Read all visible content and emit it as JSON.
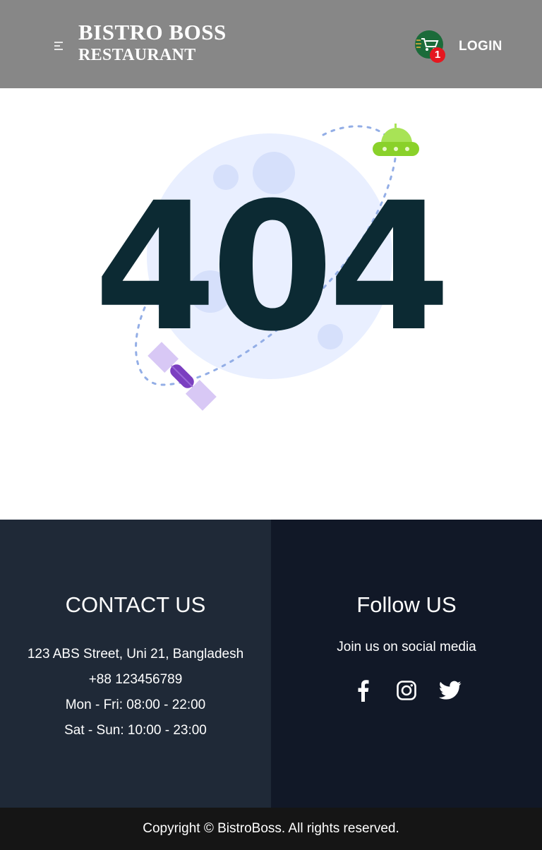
{
  "header": {
    "brand_line1": "BISTRO BOSS",
    "brand_line2": "RESTAURANT",
    "cart_count": "1",
    "login_label": "LOGIN",
    "menu_icon": "hamburger-menu-icon",
    "cart_icon": "shopping-cart-icon"
  },
  "error": {
    "code": "404"
  },
  "contact": {
    "title": "CONTACT US",
    "address": "123 ABS Street, Uni 21, Bangladesh",
    "phone": "+88 123456789",
    "weekday_hours": "Mon - Fri: 08:00 - 22:00",
    "weekend_hours": "Sat - Sun: 10:00 - 23:00"
  },
  "follow": {
    "title": "Follow US",
    "subtitle": "Join us on social media",
    "icons": [
      "facebook-icon",
      "instagram-icon",
      "twitter-icon"
    ]
  },
  "footer": {
    "copyright": "Copyright © BistroBoss. All rights reserved."
  },
  "colors": {
    "header_bg": "#878787",
    "footer_left_bg": "#1f2937",
    "footer_right_bg": "#111827",
    "copyright_bg": "#151515",
    "error_text": "#0c2a33"
  }
}
